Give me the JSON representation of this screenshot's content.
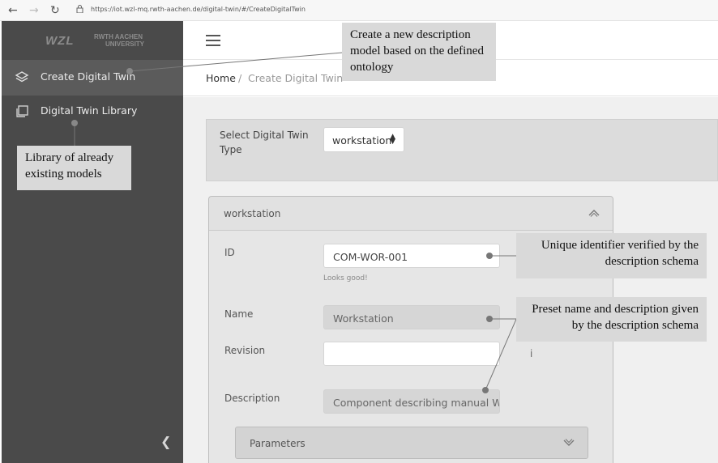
{
  "browser": {
    "back_icon": "back-arrow-icon",
    "forward_icon": "forward-arrow-icon",
    "reload_icon": "reload-icon",
    "url": "https://iot.wzl-mq.rwth-aachen.de/digital-twin/#/CreateDigitalTwin"
  },
  "sidebar": {
    "logo_left": "WZL",
    "logo_right_top": "RWTH AACHEN",
    "logo_right_bottom": "UNIVERSITY",
    "items": [
      {
        "label": "Create Digital Twin",
        "icon": "layers-icon",
        "active": true
      },
      {
        "label": "Digital Twin Library",
        "icon": "copy-icon",
        "active": false
      }
    ],
    "collapse_icon": "chevron-left-icon"
  },
  "header": {
    "menu_icon": "hamburger-menu-icon"
  },
  "breadcrumb": {
    "home": "Home",
    "separator": "/",
    "current": "Create Digital Twin"
  },
  "type_select": {
    "label": "Select Digital Twin Type",
    "value": "workstation",
    "arrow": "▲\n▼"
  },
  "workstation_panel": {
    "title": "workstation",
    "id_label": "ID",
    "id_value": "COM-WOR-001",
    "id_hint": "Looks good!",
    "name_label": "Name",
    "name_value": "Workstation",
    "revision_label": "Revision",
    "revision_value": "",
    "info_mark": "i",
    "description_label": "Description",
    "description_value": "Component describing manual Worl",
    "parameters_label": "Parameters"
  },
  "callouts": {
    "create": "Create a new description model based on the defined ontology",
    "library": "Library of already existing models",
    "unique_id": "Unique identifier verified by the description schema",
    "preset": "Preset name and description given by the description schema"
  },
  "colors": {
    "sidebar_bg": "#4a4a4a",
    "sidebar_active": "#5b5b5b",
    "content_bg": "#f0f0f0",
    "callout_bg": "#d9d9d9",
    "leader_line": "#707070"
  }
}
